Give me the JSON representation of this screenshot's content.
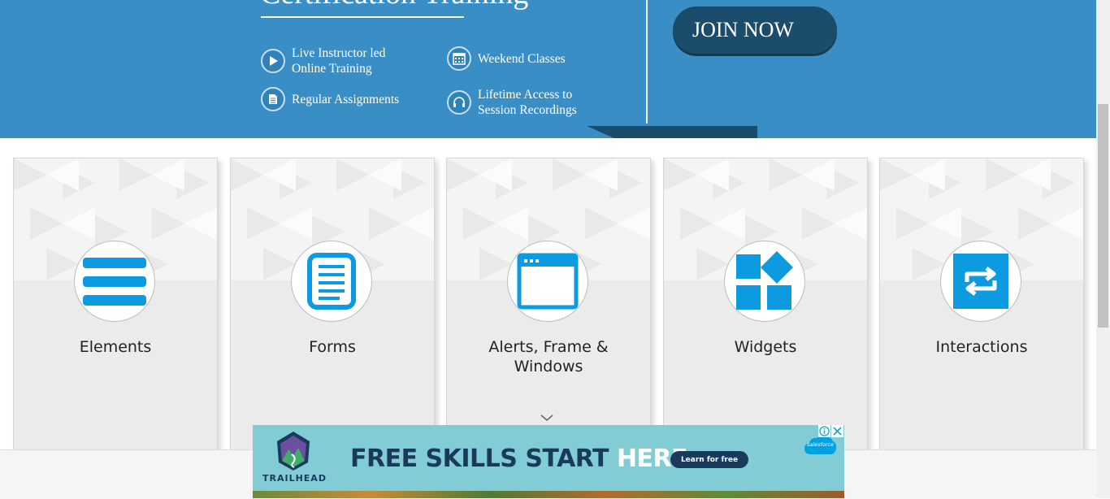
{
  "banner": {
    "title": "Certification Training",
    "features": [
      {
        "icon": "play-icon",
        "text": "Live Instructor led Online Training"
      },
      {
        "icon": "calendar-icon",
        "text": "Weekend Classes"
      },
      {
        "icon": "document-icon",
        "text": "Regular Assignments"
      },
      {
        "icon": "headphones-icon",
        "text": "Lifetime Access to Session Recordings"
      }
    ],
    "join_label": "JOIN NOW"
  },
  "cards": [
    {
      "label": "Elements",
      "icon": "hamburger-menu-icon"
    },
    {
      "label": "Forms",
      "icon": "document-form-icon"
    },
    {
      "label": "Alerts, Frame & Windows",
      "icon": "browser-window-icon"
    },
    {
      "label": "Widgets",
      "icon": "widgets-grid-icon"
    },
    {
      "label": "Interactions",
      "icon": "interactions-icon"
    }
  ],
  "ad": {
    "headline_part1": "FREE SKILLS START",
    "headline_part2": "HERE.",
    "cta": "Learn for free",
    "brand": "TRAILHEAD",
    "sponsor": "salesforce",
    "info_icon": "info-icon",
    "close_icon": "close-icon"
  },
  "colors": {
    "banner_bg": "#3a8ec6",
    "join_bg": "#1b4c6b",
    "icon_blue": "#0c9be0",
    "ad_bg": "#82ccd6",
    "ad_text": "#1a3a5c"
  }
}
